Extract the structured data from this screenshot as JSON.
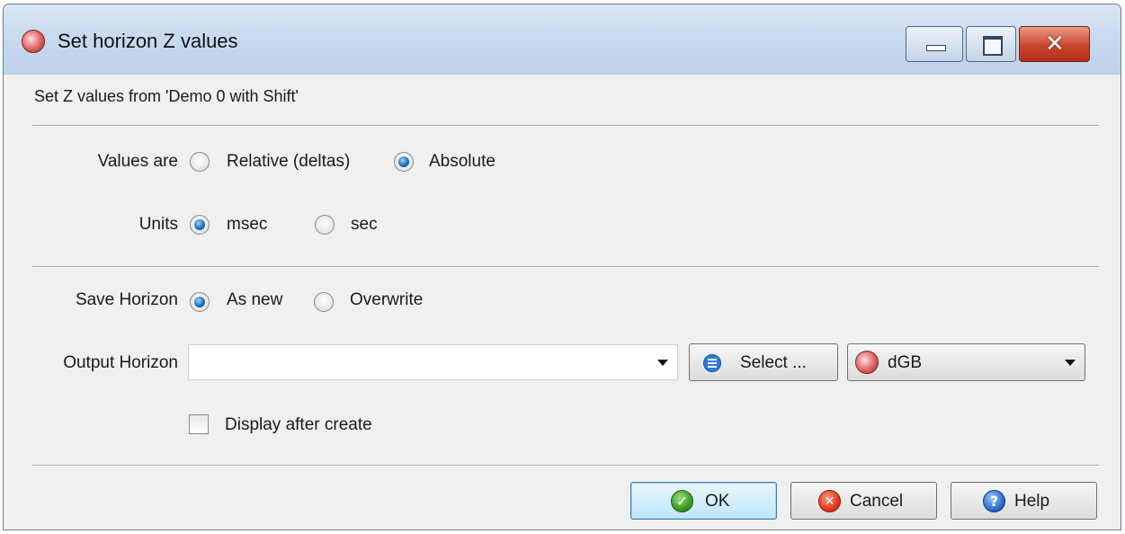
{
  "window": {
    "title": "Set horizon Z values",
    "subtitle": "Set Z values from 'Demo 0 with Shift'"
  },
  "values_are": {
    "label": "Values are",
    "options": [
      "Relative (deltas)",
      "Absolute"
    ],
    "selected": "Absolute"
  },
  "units": {
    "label": "Units",
    "options": [
      "msec",
      "sec"
    ],
    "selected": "msec"
  },
  "save_horizon": {
    "label": "Save Horizon",
    "options": [
      "As new",
      "Overwrite"
    ],
    "selected": "As new"
  },
  "output_horizon": {
    "label": "Output Horizon",
    "value": "",
    "select_label": "Select ...",
    "database_value": "dGB"
  },
  "display_after_create": {
    "label": "Display after create",
    "checked": false
  },
  "buttons": {
    "ok": "OK",
    "cancel": "Cancel",
    "help": "Help"
  },
  "icons": {
    "close": "✕",
    "check": "✓",
    "x": "✕",
    "question": "?"
  }
}
